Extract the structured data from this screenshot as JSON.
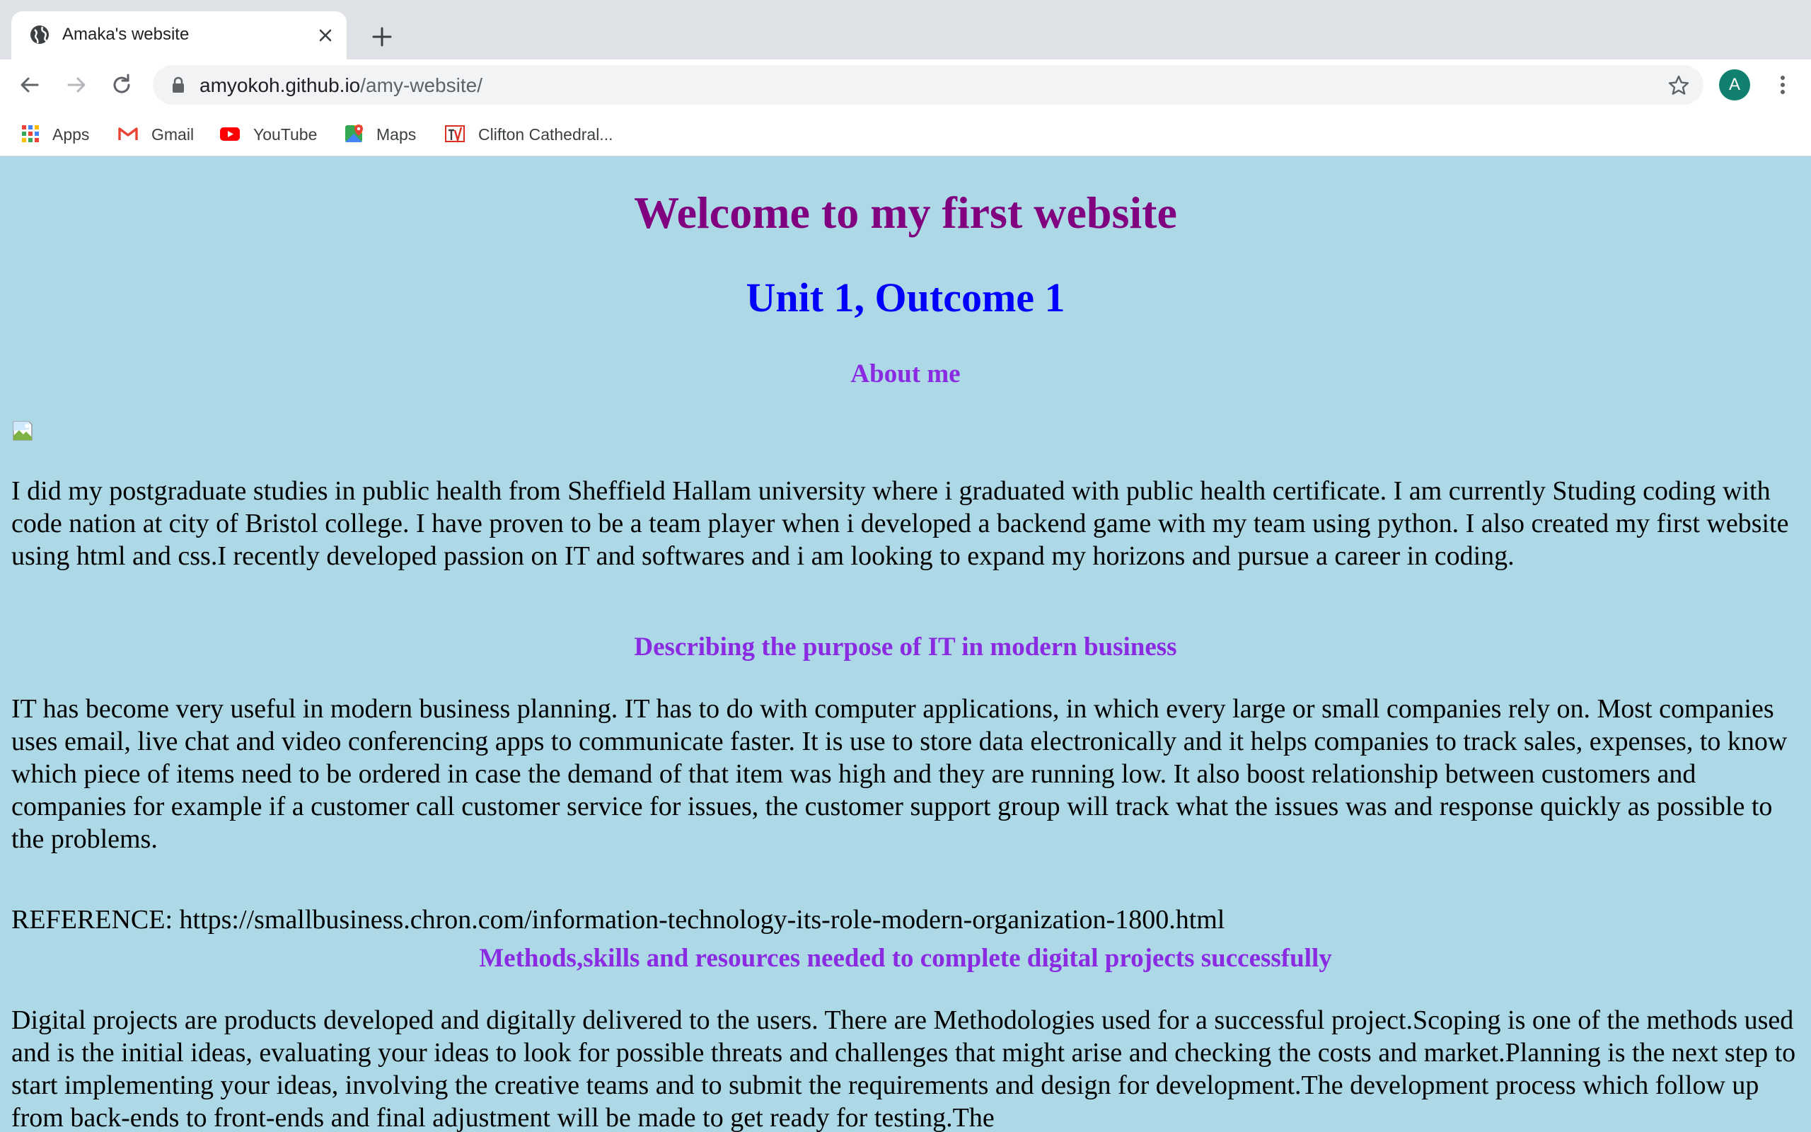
{
  "browser": {
    "tab": {
      "title": "Amaka's website",
      "favicon": "globe-icon"
    },
    "address_bar": {
      "host": "amyokoh.github.io",
      "path": "/amy-website/"
    },
    "profile_initial": "A",
    "bookmarks": [
      {
        "label": "Apps",
        "icon": "apps-grid-icon"
      },
      {
        "label": "Gmail",
        "icon": "gmail-icon"
      },
      {
        "label": "YouTube",
        "icon": "youtube-icon"
      },
      {
        "label": "Maps",
        "icon": "maps-icon"
      },
      {
        "label": "Clifton Cathedral...",
        "icon": "clifton-cathedral-icon"
      }
    ]
  },
  "page": {
    "title": "Welcome to my first website",
    "subtitle": "Unit 1, Outcome 1",
    "about_heading": "About me",
    "about_text": "I did my postgraduate studies in public health from Sheffield Hallam university where i graduated with public health certificate. I am currently Studing coding with code nation at city of Bristol college. I have proven to be a team player when i developed a backend game with my team using python. I also created my first website using html and css.I recently developed passion on IT and softwares and i am looking to expand my horizons and pursue a career in coding.",
    "purpose_heading": "Describing the purpose of IT in modern business",
    "purpose_text": "IT has become very useful in modern business planning. IT has to do with computer applications, in which every large or small companies rely on. Most companies uses email, live chat and video conferencing apps to communicate faster. It is use to store data electronically and it helps companies to track sales, expenses, to know which piece of items need to be ordered in case the demand of that item was high and they are running low. It also boost relationship between customers and companies for example if a customer call customer service for issues, the customer support group will track what the issues was and response quickly as possible to the problems.",
    "reference_text": "REFERENCE: https://smallbusiness.chron.com/information-technology-its-role-modern-organization-1800.html",
    "methods_heading": "Methods,skills and resources needed to complete digital projects successfully",
    "methods_text": "Digital projects are products developed and digitally delivered to the users. There are Methodologies used for a successful project.Scoping is one of the methods used and is the initial ideas, evaluating your ideas to look for possible threats and challenges that might arise and checking the costs and market.Planning is the next step to start implementing your ideas, involving the creative teams and to submit the requirements and design for development.The development process which follow up from back-ends to front-ends and final adjustment will be made to get ready for testing.The"
  },
  "colors": {
    "page_background": "#add8e6",
    "title": "#800080",
    "subtitle": "#0000ff",
    "section_heading": "#8a2be2"
  }
}
